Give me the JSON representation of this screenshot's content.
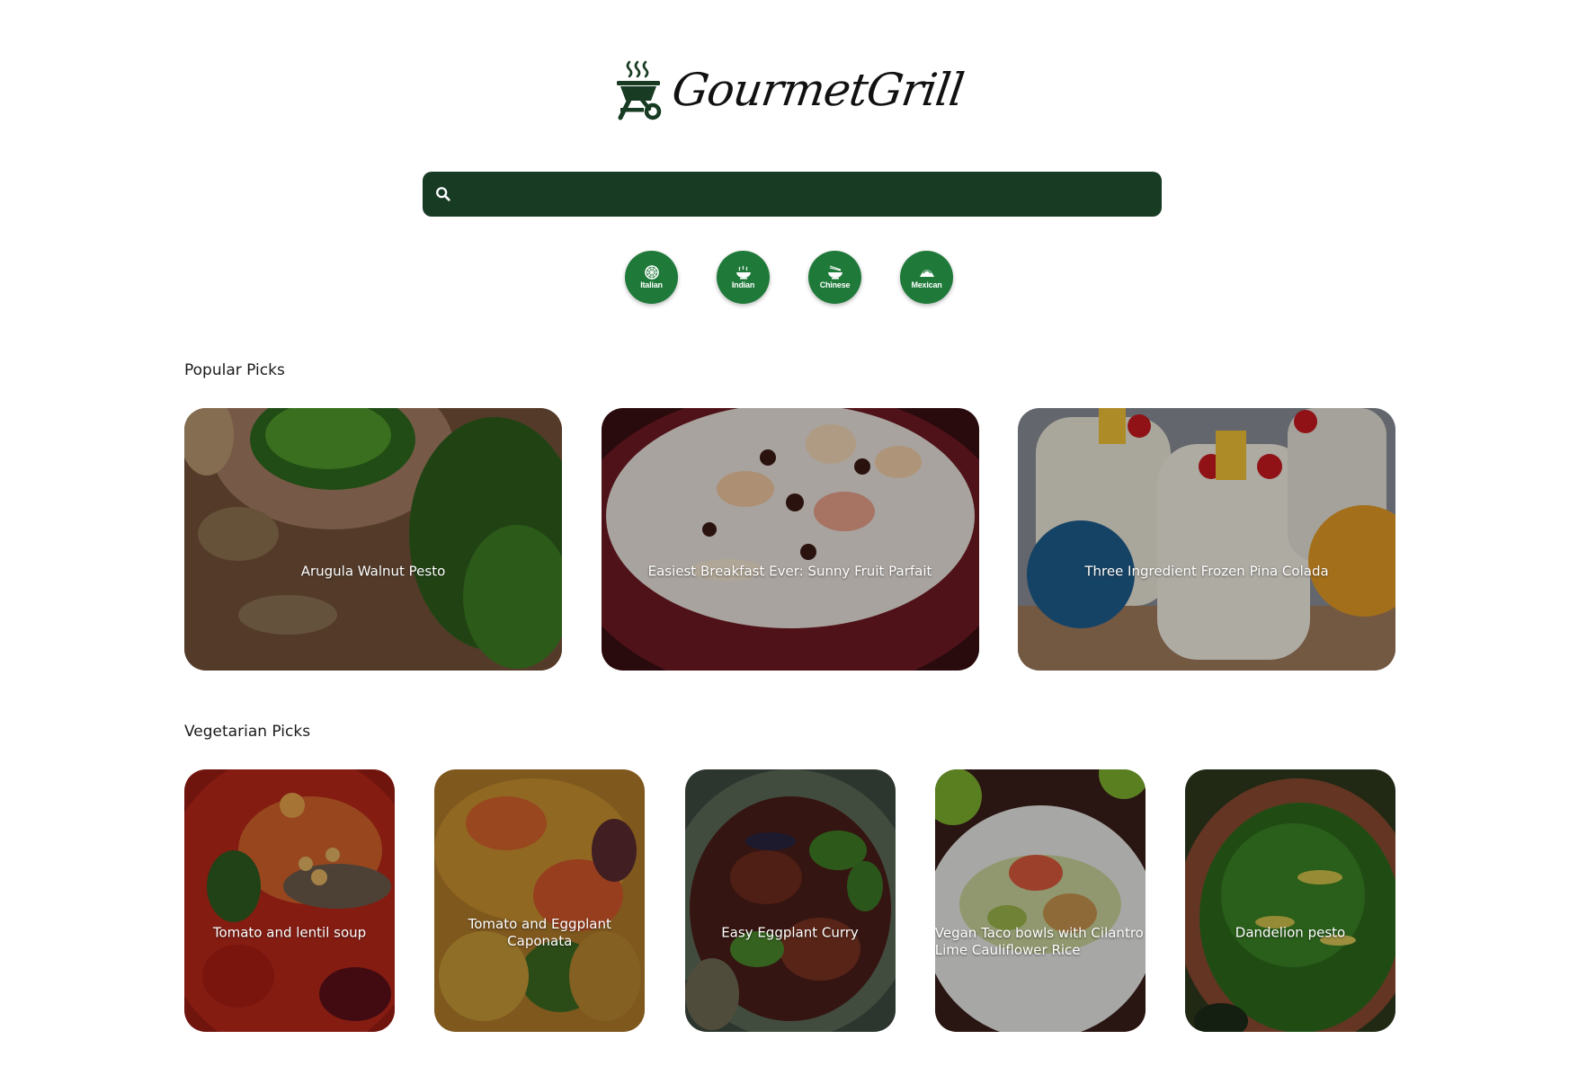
{
  "brand": {
    "name": "GourmetGrill",
    "icon": "grill-icon"
  },
  "search": {
    "placeholder": "",
    "value": "",
    "icon": "search-icon",
    "color": "#183b23"
  },
  "cuisines": [
    {
      "label": "Italian",
      "icon": "pizza-icon"
    },
    {
      "label": "Indian",
      "icon": "curry-bowl-icon"
    },
    {
      "label": "Chinese",
      "icon": "noodle-bowl-icon"
    },
    {
      "label": "Mexican",
      "icon": "taco-icon"
    }
  ],
  "cuisine_color": "#1f7a3a",
  "popular": {
    "title": "Popular Picks",
    "items": [
      {
        "title": "Arugula Walnut Pesto"
      },
      {
        "title": "Easiest Breakfast Ever: Sunny Fruit Parfait"
      },
      {
        "title": "Three Ingredient Frozen Pina Colada"
      }
    ]
  },
  "vegetarian": {
    "title": "Vegetarian Picks",
    "items": [
      {
        "title": "Tomato and lentil soup"
      },
      {
        "title": "Tomato and Eggplant Caponata"
      },
      {
        "title": "Easy Eggplant Curry"
      },
      {
        "title": "Vegan Taco bowls with Cilantro Lime Cauliflower Rice"
      },
      {
        "title": "Dandelion pesto"
      }
    ]
  }
}
